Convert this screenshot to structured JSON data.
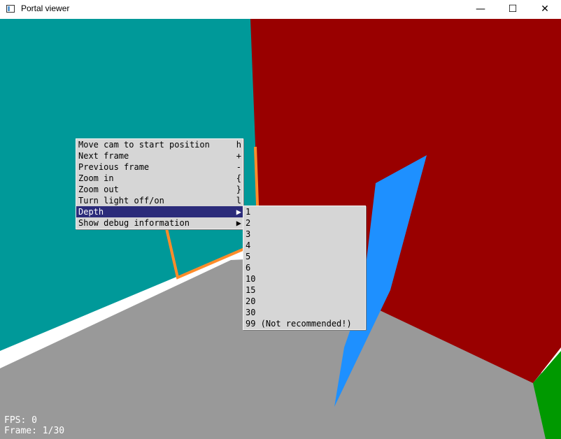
{
  "window": {
    "title": "Portal viewer",
    "controls": {
      "minimize": "—",
      "maximize": "☐",
      "close": "✕"
    }
  },
  "scene": {
    "colors": {
      "left_wall": "#009999",
      "right_wall": "#990000",
      "floor": "#999999",
      "blade": "#1e90ff",
      "portal_frame": "#ff8c2a",
      "corner": "#009900"
    }
  },
  "hud": {
    "fps": "FPS: 0",
    "frame": "Frame: 1/30"
  },
  "context_menu": {
    "items": [
      {
        "label": "Move cam to start position",
        "shortcut": "h"
      },
      {
        "label": "Next frame",
        "shortcut": "+"
      },
      {
        "label": "Previous frame",
        "shortcut": "-"
      },
      {
        "label": "Zoom in",
        "shortcut": "{"
      },
      {
        "label": "Zoom out",
        "shortcut": "}"
      },
      {
        "label": "Turn light off/on",
        "shortcut": "l"
      },
      {
        "label": "Depth",
        "shortcut": "▶"
      },
      {
        "label": "Show debug information",
        "shortcut": "▶"
      }
    ],
    "active_item": "Depth"
  },
  "depth_submenu": {
    "options": [
      "1",
      "2",
      "3",
      "4",
      "5",
      "6",
      "10",
      "15",
      "20",
      "30",
      "99 (Not recommended!)"
    ]
  }
}
